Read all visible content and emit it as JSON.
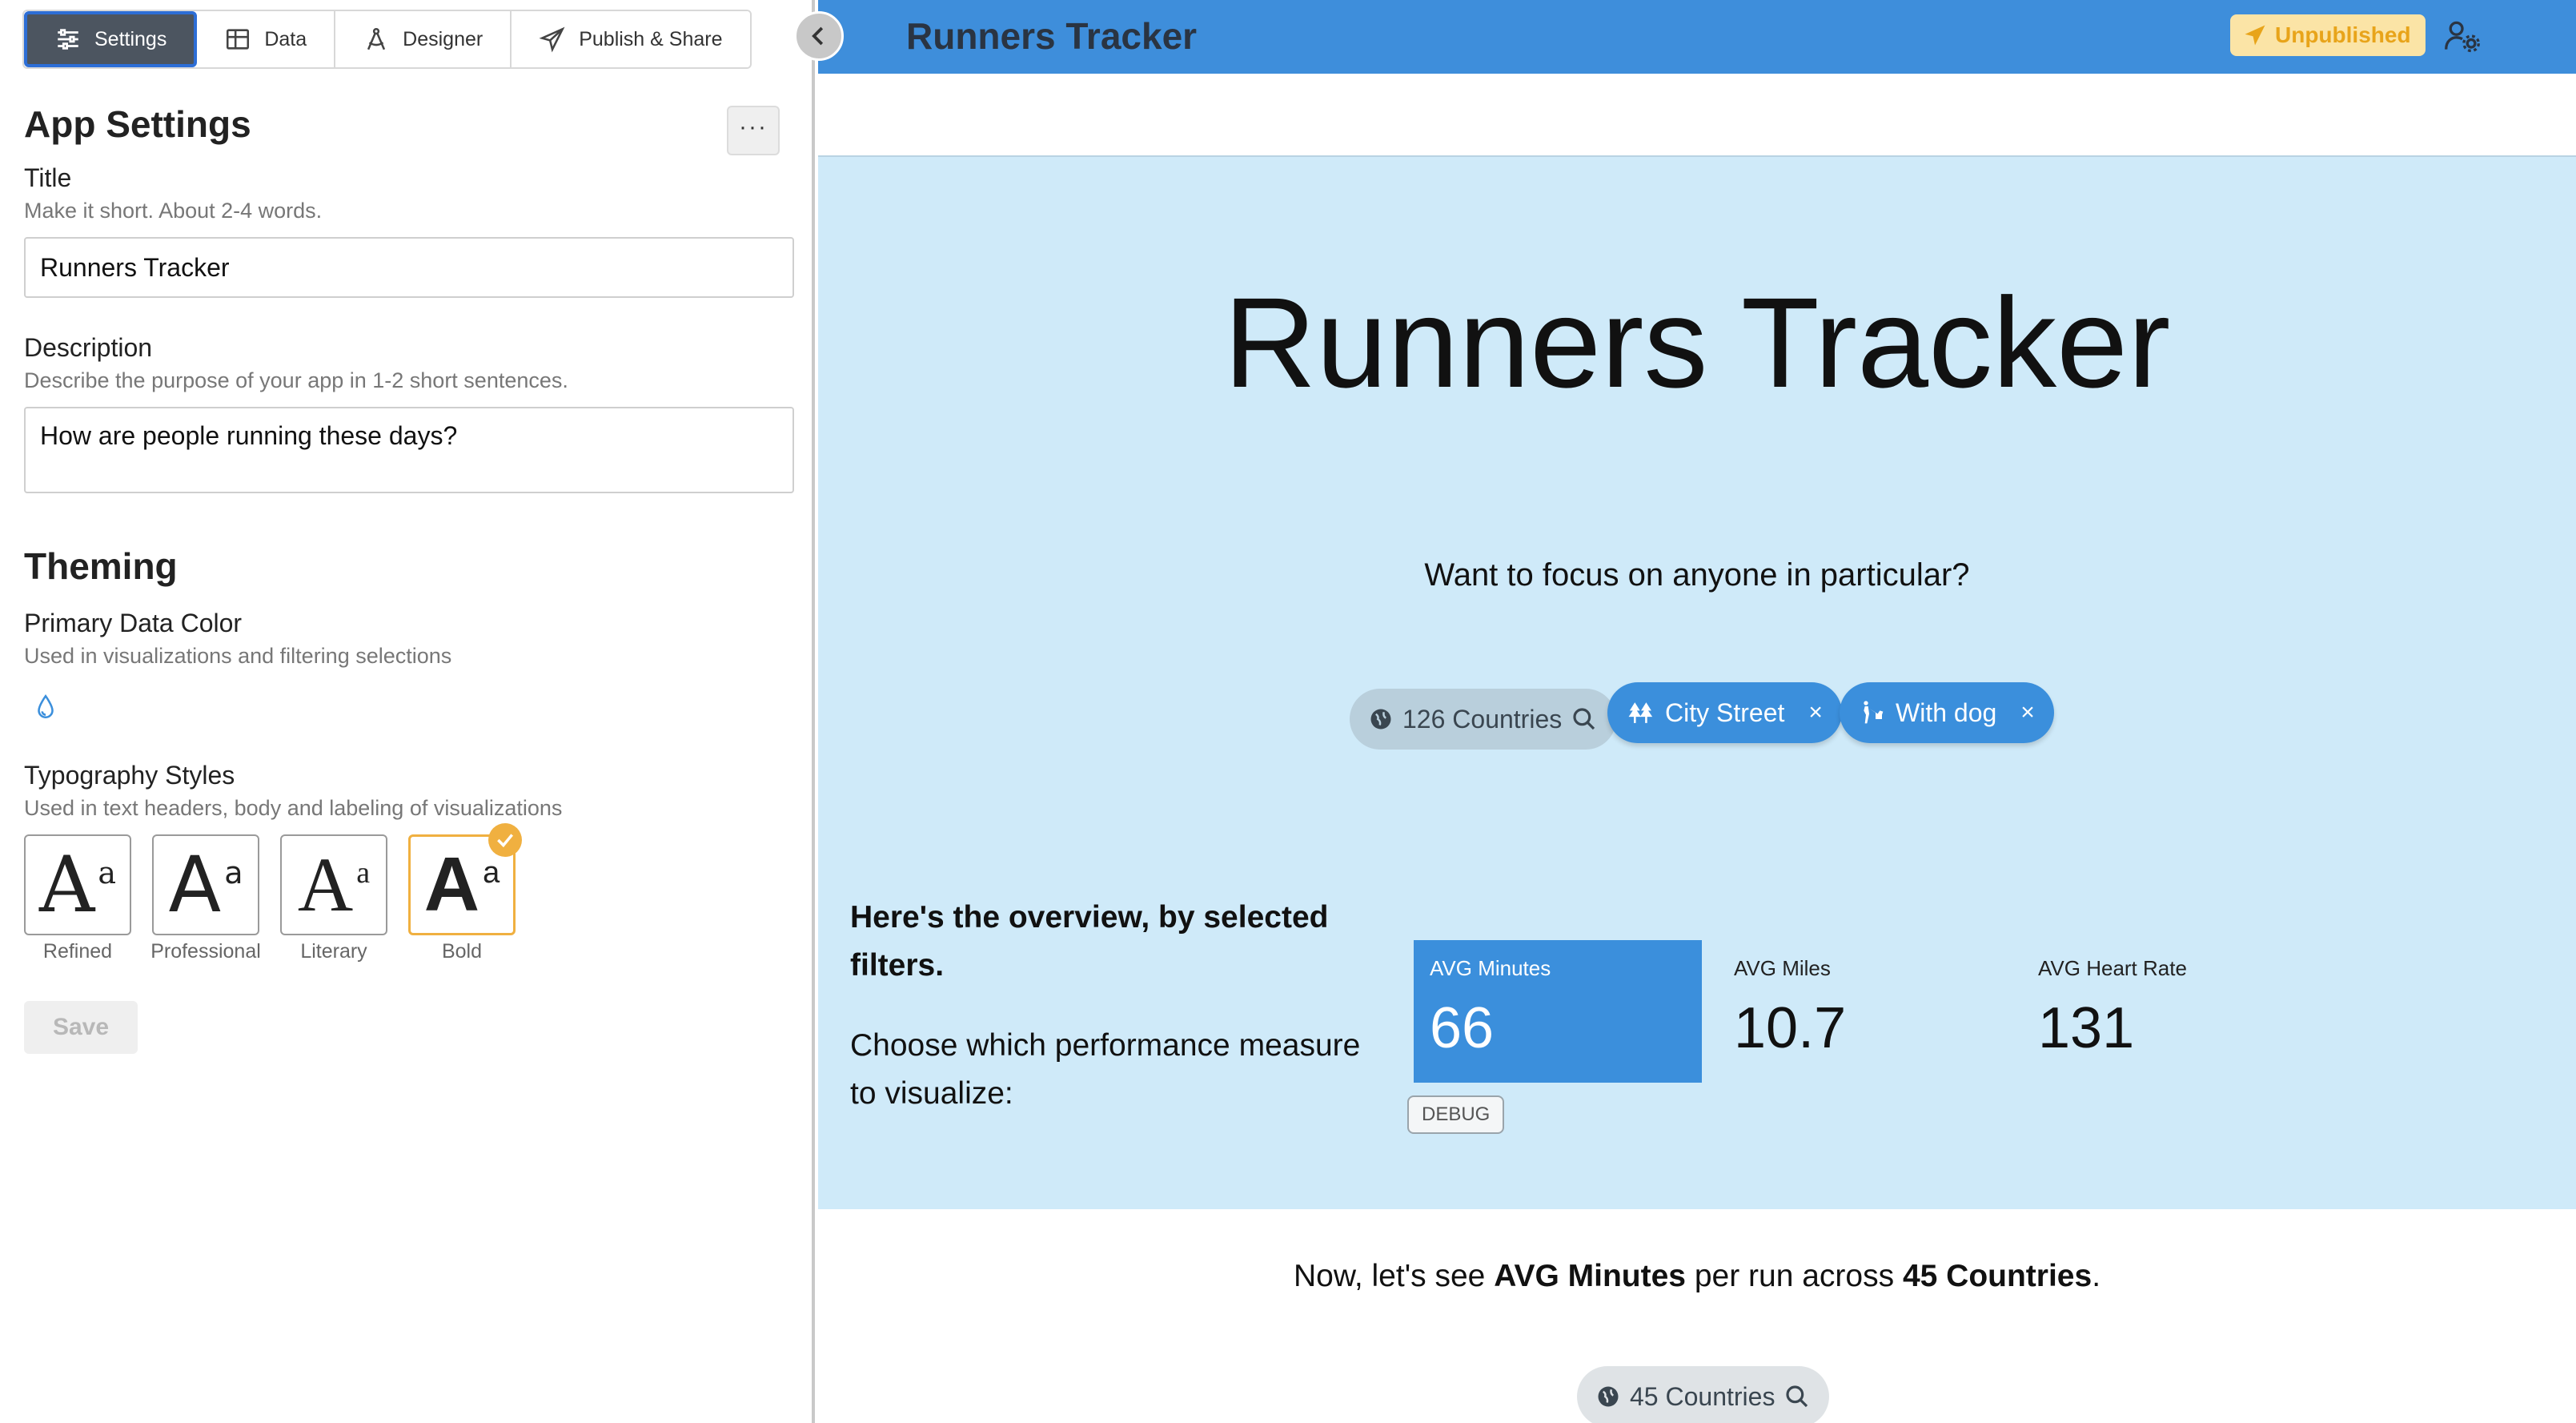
{
  "tabs": [
    {
      "label": "Settings",
      "icon": "sliders-icon",
      "active": true
    },
    {
      "label": "Data",
      "icon": "table-icon",
      "active": false
    },
    {
      "label": "Designer",
      "icon": "compass-icon",
      "active": false
    },
    {
      "label": "Publish & Share",
      "icon": "paper-plane-icon",
      "active": false
    }
  ],
  "settings": {
    "heading": "App Settings",
    "more_label": "···",
    "title_label": "Title",
    "title_hint": "Make it short. About 2-4 words.",
    "title_value": "Runners Tracker",
    "description_label": "Description",
    "description_hint": "Describe the purpose of your app in 1-2 short sentences.",
    "description_value": "How are people running these days?",
    "theming_heading": "Theming",
    "primary_color_label": "Primary Data Color",
    "primary_color_hint": "Used in visualizations and filtering selections",
    "typography_label": "Typography Styles",
    "typography_hint": "Used in text headers, body and labeling of visualizations",
    "typography_options": [
      {
        "label": "Refined",
        "sample_big": "A",
        "sample_small": "a",
        "selected": false
      },
      {
        "label": "Professional",
        "sample_big": "A",
        "sample_small": "a",
        "selected": false
      },
      {
        "label": "Literary",
        "sample_big": "A",
        "sample_small": "a",
        "selected": false
      },
      {
        "label": "Bold",
        "sample_big": "A",
        "sample_small": "a",
        "selected": true
      }
    ],
    "save_label": "Save"
  },
  "app": {
    "header_title": "Runners Tracker",
    "status_badge": "Unpublished",
    "hero_title": "Runners Tracker",
    "focus_prompt": "Want to focus on anyone in particular?",
    "filters": {
      "countries": "126 Countries",
      "chip_city": "City Street",
      "chip_dog": "With dog",
      "remove_label": "×"
    },
    "overview_text": "Here's the overview, by selected filters.",
    "choose_text": "Choose which performance measure to visualize:",
    "metrics": [
      {
        "label": "AVG Minutes",
        "value": "66",
        "active": true
      },
      {
        "label": "AVG Miles",
        "value": "10.7",
        "active": false
      },
      {
        "label": "AVG Heart Rate",
        "value": "131",
        "active": false
      }
    ],
    "debug_label": "DEBUG",
    "now_prefix": "Now, let's see ",
    "now_measure": "AVG Minutes",
    "now_middle": " per run across ",
    "now_countries": "45 Countries",
    "now_suffix": ".",
    "countries_chip2": "45 Countries"
  },
  "colors": {
    "topbar": "#3e8edb",
    "hero_background": "#cfeaf9",
    "accent": "#3b8fdc",
    "badge_text": "#e8a41a",
    "badge_background": "#fbe4a6",
    "selected_typography": "#f0b040"
  }
}
